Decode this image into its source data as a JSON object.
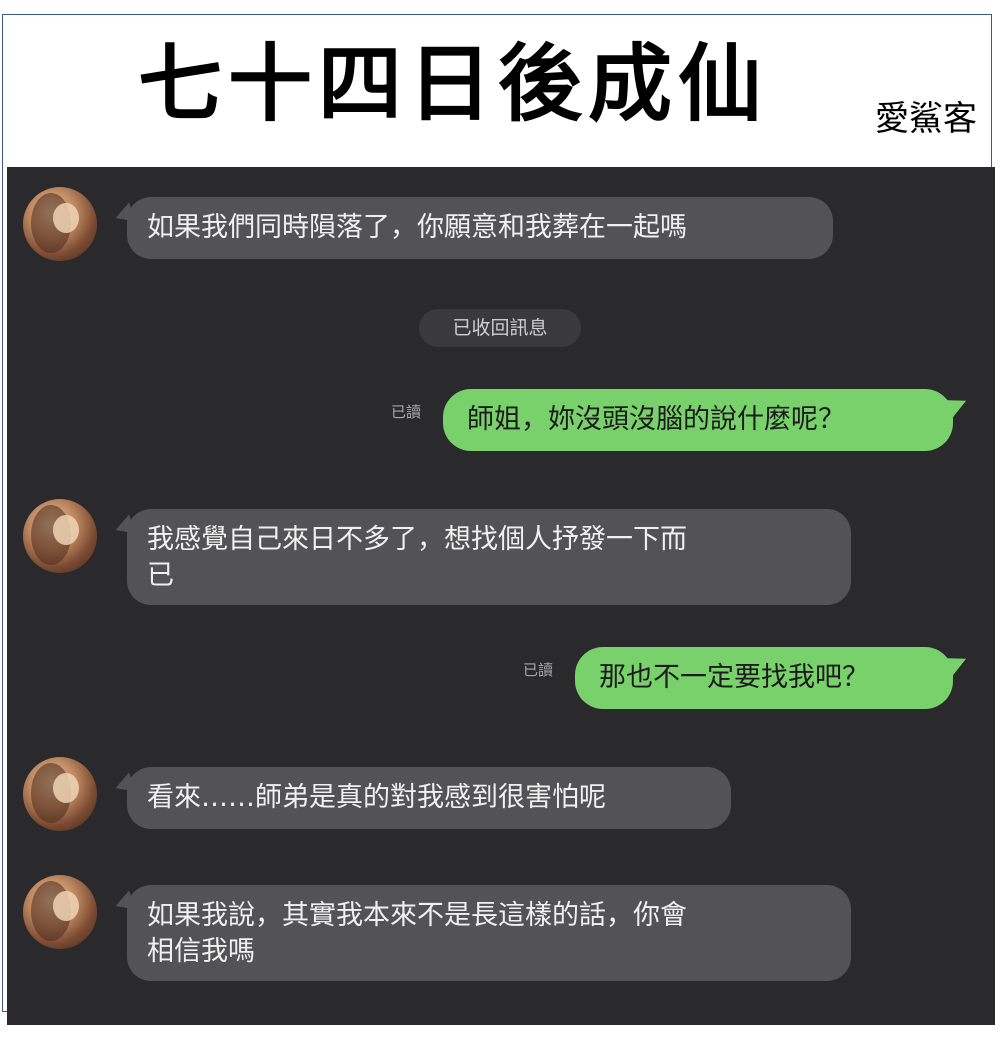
{
  "header": {
    "title": "七十四日後成仙",
    "author": "愛鯊客"
  },
  "chat": {
    "messages": [
      {
        "side": "in",
        "text": "如果我們同時隕落了，你願意和我葬在一起嗎"
      },
      {
        "side": "system",
        "text": "已收回訊息"
      },
      {
        "side": "out",
        "read": "已讀",
        "text": "師姐，妳沒頭沒腦的說什麼呢？"
      },
      {
        "side": "in",
        "line1": "我感覺自己來日不多了，想找個人抒發一下而",
        "line2": "已"
      },
      {
        "side": "out",
        "read": "已讀",
        "text": "那也不一定要找我吧？"
      },
      {
        "side": "in",
        "text": "看來……師弟是真的對我感到很害怕呢"
      },
      {
        "side": "in",
        "line1": "如果我說，其實我本來不是長這樣的話，你會",
        "line2": "相信我嗎"
      }
    ]
  },
  "colors": {
    "chat_background": "#2a2a2c",
    "incoming_bubble": "#535355",
    "outgoing_bubble": "#79d16c",
    "system_pill": "#3a3a3c"
  },
  "icons": {
    "avatar": "avatar-photo"
  }
}
